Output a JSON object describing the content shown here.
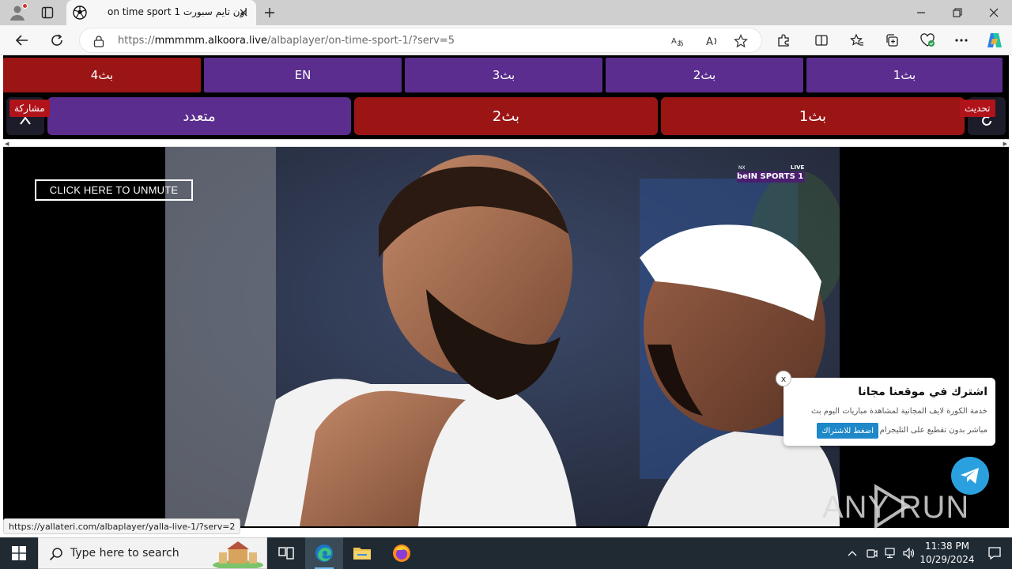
{
  "browser": {
    "tab_title": "on time sport 1 اون تايم سبورت",
    "url_prefix": "https://",
    "url_host": "mmmmm.alkoora.live",
    "url_path": "/albaplayer/on-time-sport-1/?serv=5",
    "status_link": "https://yallateri.com/albaplayer/yalla-live-1/?serv=2"
  },
  "servers": {
    "row1": [
      "بث4",
      "EN",
      "بث3",
      "بث2",
      "بث1"
    ],
    "row2": [
      "متعدد",
      "بث2",
      "بث1"
    ],
    "share_label": "مشاركة",
    "refresh_label": "تحديث"
  },
  "colors": {
    "active_red": "#9b1515",
    "purple": "#5b2d8e",
    "telegram": "#2aa1de"
  },
  "player": {
    "unmute_label": "CLICK HERE TO UNMUTE",
    "channel_badge": "beIN SPORTS 1",
    "live_label": "LIVE"
  },
  "popup": {
    "title": "اشترك في موقعنا مجانا",
    "desc_line1": "خدمة الكورة لايف المجانية لمشاهدة مباريات اليوم بث",
    "desc_line2": "مباشر بدون تقطيع على التليجرام",
    "button": "اضغط للاشتراك",
    "close": "x"
  },
  "watermark": "ANY RUN",
  "taskbar": {
    "search_placeholder": "Type here to search",
    "time": "11:38 PM",
    "date": "10/29/2024"
  }
}
